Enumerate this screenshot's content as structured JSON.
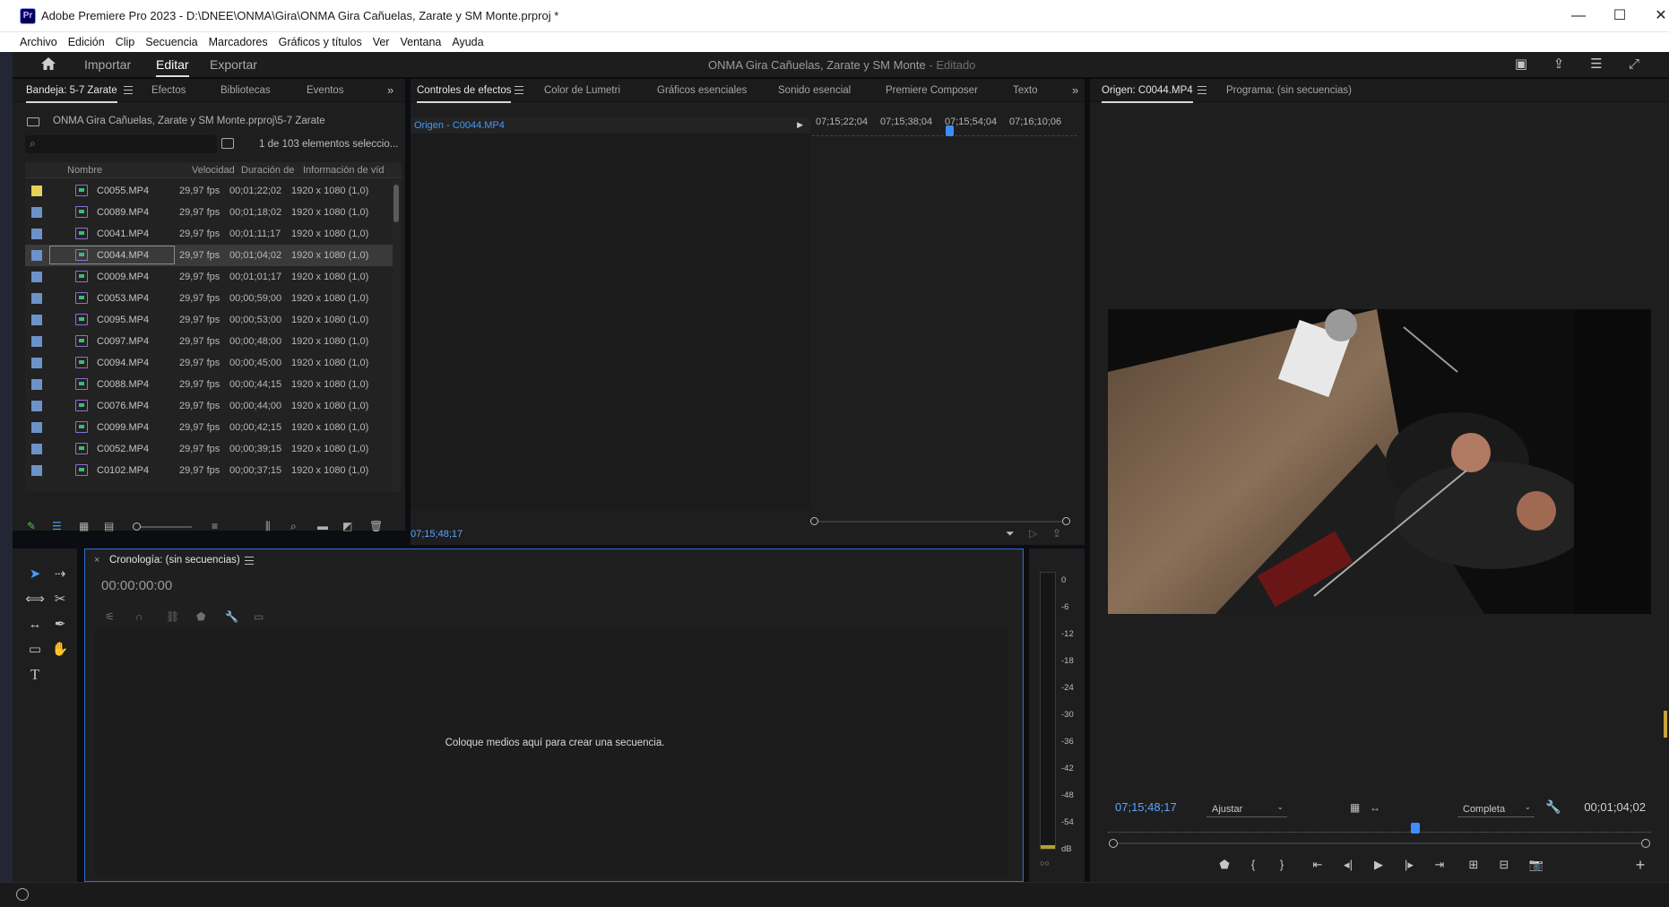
{
  "window": {
    "app_icon": "Pr",
    "title": "Adobe Premiere Pro 2023 - D:\\DNEE\\ONMA\\Gira\\ONMA Gira Cañuelas, Zarate y SM Monte.prproj *",
    "minimize": "—",
    "maximize": "☐",
    "close": "✕"
  },
  "menu": [
    "Archivo",
    "Edición",
    "Clip",
    "Secuencia",
    "Marcadores",
    "Gráficos y títulos",
    "Ver",
    "Ventana",
    "Ayuda"
  ],
  "header": {
    "tabs": [
      "Importar",
      "Editar",
      "Exportar"
    ],
    "active_tab": "Editar",
    "project_title": "ONMA Gira Cañuelas, Zarate y SM Monte",
    "project_status": " - Editado"
  },
  "project_panel": {
    "tabs": [
      "Bandeja: 5-7 Zarate",
      "Efectos",
      "Bibliotecas",
      "Eventos"
    ],
    "path": "ONMA Gira Cañuelas, Zarate y SM Monte.prproj\\5-7 Zarate",
    "search_placeholder": "",
    "item_count": "1 de 103 elementos seleccio...",
    "columns": [
      "Nombre",
      "Velocidad",
      "Duración de",
      "Información de víd"
    ],
    "rows": [
      {
        "name": "C0055.MP4",
        "fps": "29,97 fps",
        "dur": "00;01;22;02",
        "vid": "1920 x 1080 (1,0)",
        "label_color": "#e4d25a"
      },
      {
        "name": "C0089.MP4",
        "fps": "29,97 fps",
        "dur": "00;01;18;02",
        "vid": "1920 x 1080 (1,0)",
        "label_color": "#6d92c8"
      },
      {
        "name": "C0041.MP4",
        "fps": "29,97 fps",
        "dur": "00;01;11;17",
        "vid": "1920 x 1080 (1,0)",
        "label_color": "#6d92c8"
      },
      {
        "name": "C0044.MP4",
        "fps": "29,97 fps",
        "dur": "00;01;04;02",
        "vid": "1920 x 1080 (1,0)",
        "label_color": "#6d92c8",
        "selected": true
      },
      {
        "name": "C0009.MP4",
        "fps": "29,97 fps",
        "dur": "00;01;01;17",
        "vid": "1920 x 1080 (1,0)",
        "label_color": "#6d92c8"
      },
      {
        "name": "C0053.MP4",
        "fps": "29,97 fps",
        "dur": "00;00;59;00",
        "vid": "1920 x 1080 (1,0)",
        "label_color": "#6d92c8"
      },
      {
        "name": "C0095.MP4",
        "fps": "29,97 fps",
        "dur": "00;00;53;00",
        "vid": "1920 x 1080 (1,0)",
        "label_color": "#6d92c8"
      },
      {
        "name": "C0097.MP4",
        "fps": "29,97 fps",
        "dur": "00;00;48;00",
        "vid": "1920 x 1080 (1,0)",
        "label_color": "#6d92c8"
      },
      {
        "name": "C0094.MP4",
        "fps": "29,97 fps",
        "dur": "00;00;45;00",
        "vid": "1920 x 1080 (1,0)",
        "label_color": "#6d92c8"
      },
      {
        "name": "C0088.MP4",
        "fps": "29,97 fps",
        "dur": "00;00;44;15",
        "vid": "1920 x 1080 (1,0)",
        "label_color": "#6d92c8"
      },
      {
        "name": "C0076.MP4",
        "fps": "29,97 fps",
        "dur": "00;00;44;00",
        "vid": "1920 x 1080 (1,0)",
        "label_color": "#6d92c8"
      },
      {
        "name": "C0099.MP4",
        "fps": "29,97 fps",
        "dur": "00;00;42;15",
        "vid": "1920 x 1080 (1,0)",
        "label_color": "#6d92c8"
      },
      {
        "name": "C0052.MP4",
        "fps": "29,97 fps",
        "dur": "00;00;39;15",
        "vid": "1920 x 1080 (1,0)",
        "label_color": "#6d92c8"
      },
      {
        "name": "C0102.MP4",
        "fps": "29,97 fps",
        "dur": "00;00;37;15",
        "vid": "1920 x 1080 (1,0)",
        "label_color": "#6d92c8"
      }
    ]
  },
  "effects_panel": {
    "tabs": [
      "Controles de efectos",
      "Color de Lumetri",
      "Gráficos esenciales",
      "Sonido esencial",
      "Premiere Composer",
      "Texto"
    ],
    "source_label": "Origen - C0044.MP4",
    "ruler": [
      "07;15;22;04",
      "07;15;38;04",
      "07;15;54;04",
      "07;16;10;06"
    ],
    "timecode": "07;15;48;17"
  },
  "source_monitor": {
    "tabs": [
      "Origen: C0044.MP4",
      "Programa: (sin secuencias)"
    ],
    "timecode_current": "07;15;48;17",
    "timecode_duration": "00;01;04;02",
    "zoom": "Ajustar",
    "resolution": "Completa"
  },
  "timeline": {
    "title": "Cronología: (sin secuencias)",
    "timecode": "00:00:00:00",
    "empty_message": "Coloque medios aquí para crear una secuencia."
  },
  "audio_meter": {
    "labels": [
      "0",
      "-6",
      "-12",
      "-18",
      "-24",
      "-30",
      "-36",
      "-42",
      "-48",
      "-54",
      "dB"
    ],
    "solo": "○○"
  },
  "colors": {
    "accent_blue": "#3f9bff",
    "panel_bg": "#1e1e1e",
    "label_yellow": "#e4d25a",
    "label_blue": "#6d92c8"
  }
}
